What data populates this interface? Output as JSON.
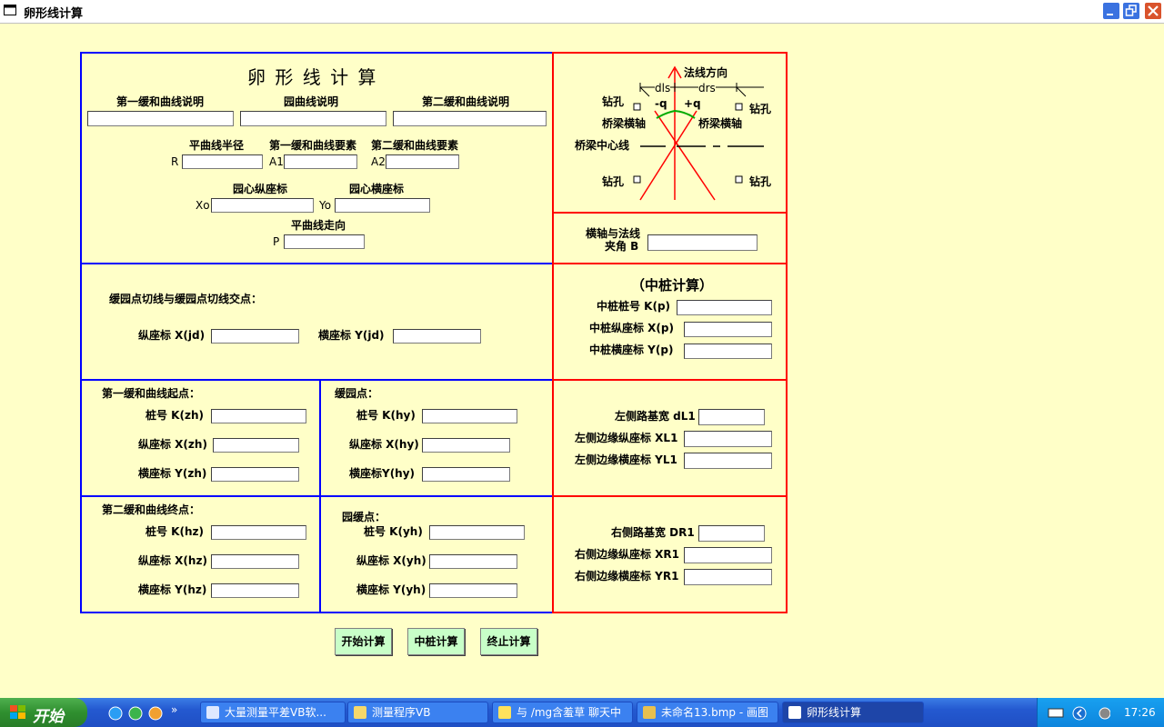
{
  "window": {
    "title": "卵形线计算"
  },
  "form": {
    "heading": "卵 形 线 计 算",
    "desc1_label": "第一缓和曲线说明",
    "desc_circle_label": "园曲线说明",
    "desc2_label": "第二缓和曲线说明",
    "radius_label": "平曲线半径",
    "a1_elements_label": "第一缓和曲线要素",
    "a2_elements_label": "第二缓和曲线要素",
    "r_prefix": "R",
    "a1_prefix": "A1",
    "a2_prefix": "A2",
    "xo_label": "园心纵座标",
    "yo_label": "园心横座标",
    "xo_prefix": "Xo",
    "yo_prefix": "Yo",
    "direction_label": "平曲线走向",
    "p_prefix": "P",
    "jd_title": "缓园点切线与缓园点切线交点：",
    "xjd_label": "纵座标 X(jd)",
    "yjd_label": "横座标 Y(jd)",
    "zh_title": "第一缓和曲线起点：",
    "kzh_label": "桩号 K(zh)",
    "xzh_label": "纵座标 X(zh)",
    "yzh_label": "横座标 Y(zh)",
    "hy_title": "缓园点：",
    "khy_label": "桩号 K(hy)",
    "xhy_label": "纵座标 X(hy)",
    "yhy_label": "横座标Y(hy)",
    "hz_title": "第二缓和曲线终点：",
    "khz_label": "桩号 K(hz)",
    "xhz_label": "纵座标 X(hz)",
    "yhz_label": "横座标 Y(hz)",
    "yh_title": "园缓点：",
    "kyh_label": "桩号 K(yh)",
    "xyh_label": "纵座标 X(yh)",
    "yyh_label": "横座标 Y(yh)"
  },
  "diagram": {
    "normal_dir": "法线方向",
    "dls": "dls",
    "drs": "drs",
    "minus_q": "-q",
    "plus_q": "+q",
    "drill": "钻孔",
    "bridge_axis": "桥梁横轴",
    "bridge_center": "桥梁中心线"
  },
  "right": {
    "angle_label_1": "横轴与法线",
    "angle_label_2": "夹角 B",
    "center_title": "（中桩计算）",
    "kp_label": "中桩桩号 K(p)",
    "xp_label": "中桩纵座标 X(p)",
    "yp_label": "中桩横座标 Y(p)",
    "dl1_label": "左侧路基宽 dL1",
    "xl1_label": "左侧边缘纵座标 XL1",
    "yl1_label": "左侧边缘横座标 YL1",
    "dr1_label": "右侧路基宽 DR1",
    "xr1_label": "右侧边缘纵座标 XR1",
    "yr1_label": "右侧边缘横座标 YR1"
  },
  "buttons": {
    "start": "开始计算",
    "center": "中桩计算",
    "stop": "终止计算"
  },
  "taskbar": {
    "start": "开始",
    "tasks": [
      "大量测量平差VB软...",
      "测量程序VB",
      "与 /mg含羞草 聊天中",
      "未命名13.bmp - 画图",
      "卵形线计算"
    ],
    "clock": "17:26"
  },
  "colors": {
    "background": "#ffffc8",
    "blue_frame": "#0000ff",
    "red_frame": "#ff0000",
    "button": "#c8ffc8"
  }
}
